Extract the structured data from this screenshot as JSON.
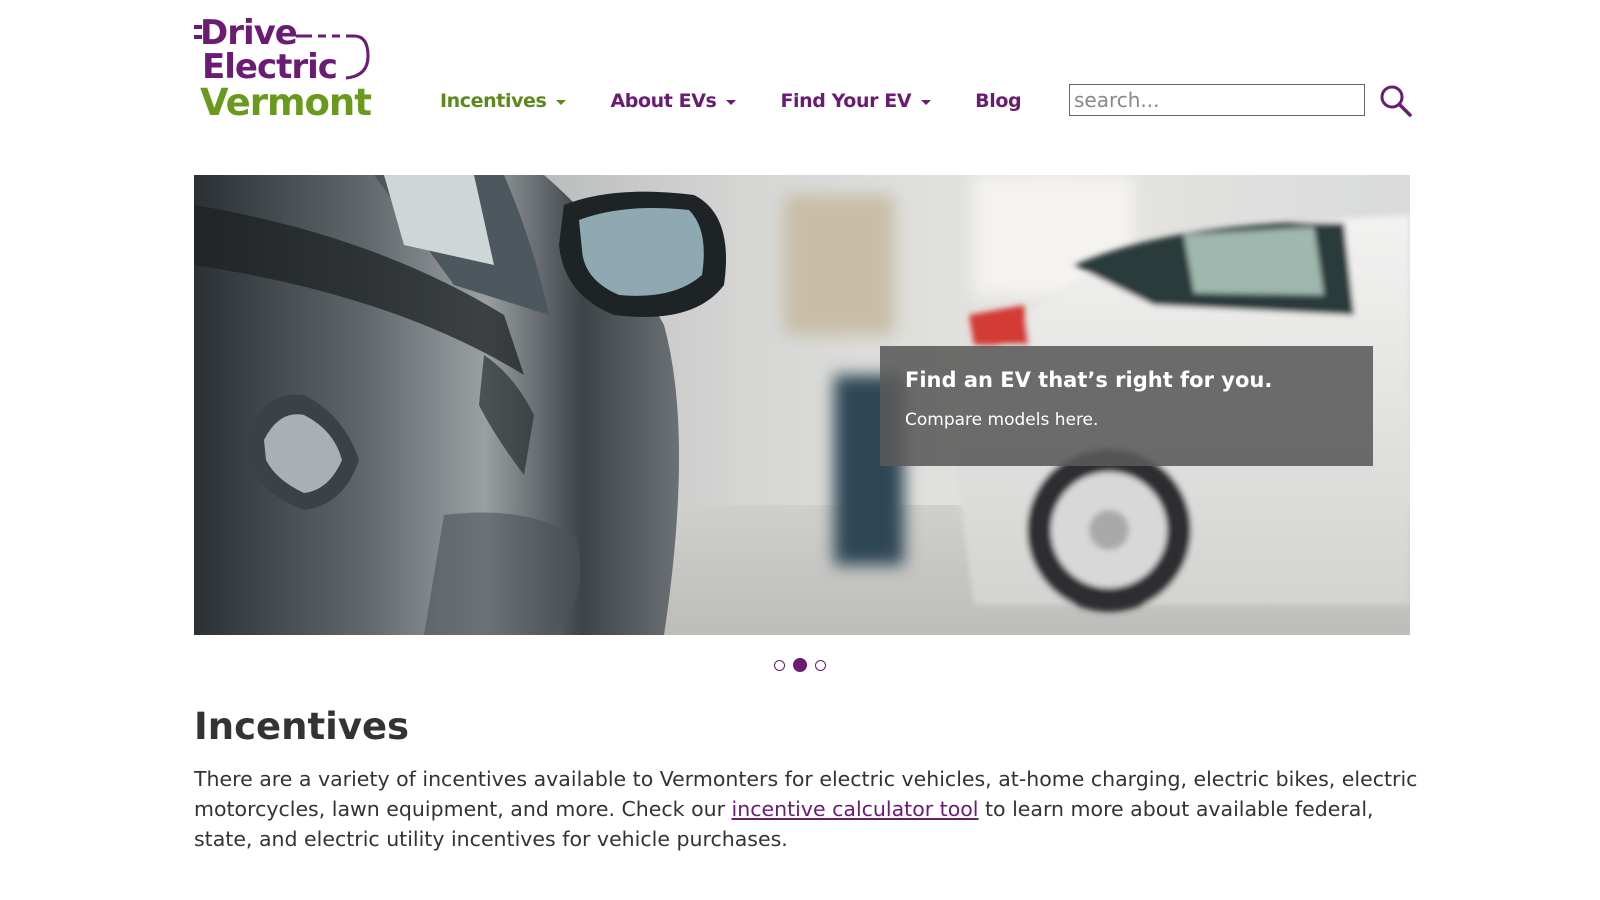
{
  "logo": {
    "line1": "Drive",
    "line2": "Electric",
    "line3": "Vermont",
    "colors": {
      "purple": "#6b1b73",
      "green": "#6a9a1c"
    }
  },
  "nav": {
    "items": [
      {
        "label": "Incentives",
        "has_dropdown": true,
        "active": true
      },
      {
        "label": "About EVs",
        "has_dropdown": true,
        "active": false
      },
      {
        "label": "Find Your EV",
        "has_dropdown": true,
        "active": false
      },
      {
        "label": "Blog",
        "has_dropdown": false,
        "active": false
      }
    ]
  },
  "search": {
    "placeholder": "search...",
    "value": "",
    "button_icon": "magnifier-icon"
  },
  "carousel": {
    "slide_image": "car-showroom-photo",
    "caption_title": "Find an EV that’s right for you.",
    "caption_text": "Compare models here.",
    "slide_count": 3,
    "active_index": 1
  },
  "incentives": {
    "title": "Incentives",
    "body_before_link": "There are a variety of incentives available to Vermonters for electric vehicles, at-home charging, electric bikes, electric motorcycles, lawn equipment, and more. Check our ",
    "link_text": "incentive calculator tool",
    "body_after_link": " to learn more about available federal, state, and electric utility incentives for vehicle purchases."
  },
  "colors": {
    "brand_purple": "#6b1b73",
    "brand_green": "#5c8a1a",
    "text": "#333333",
    "caption_bg": "#5a5a5a"
  }
}
